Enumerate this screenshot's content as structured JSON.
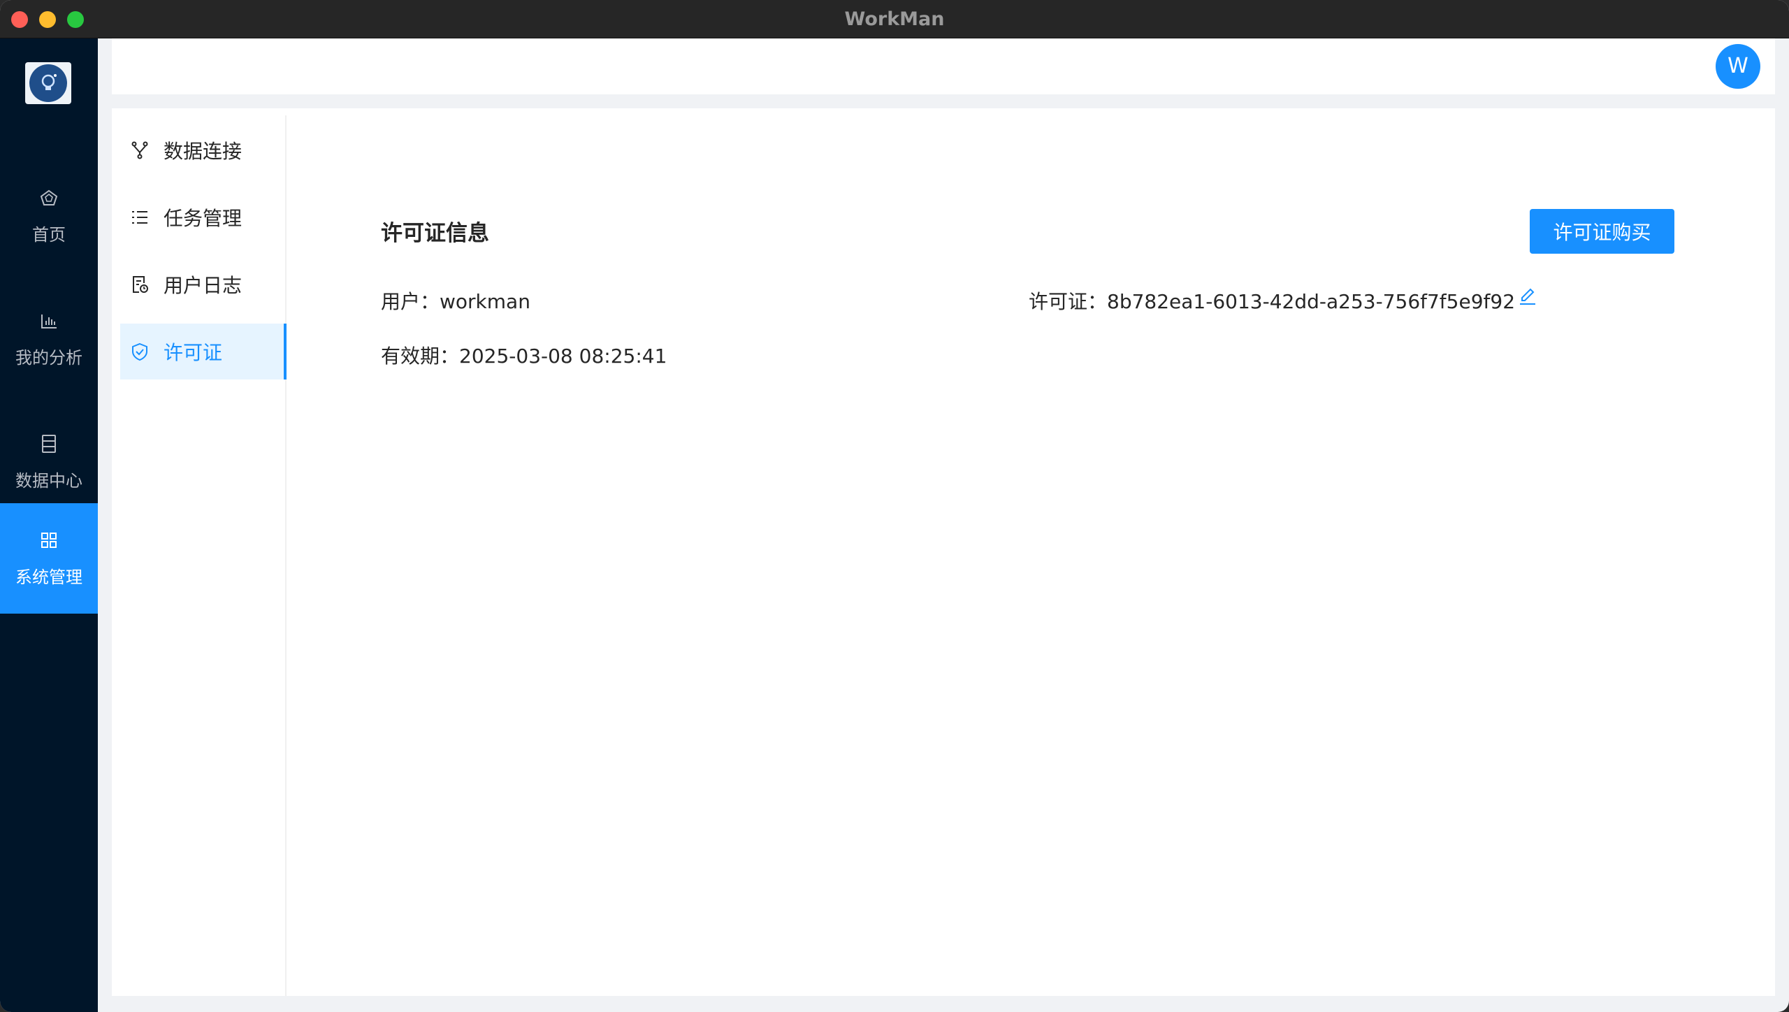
{
  "window": {
    "title": "WorkMan"
  },
  "rail": {
    "items": [
      {
        "label": "首页",
        "icon": "home-icon"
      },
      {
        "label": "我的分析",
        "icon": "bar-chart-icon"
      },
      {
        "label": "数据中心",
        "icon": "database-icon"
      },
      {
        "label": "系统管理",
        "icon": "grid-icon",
        "active": true
      }
    ]
  },
  "header": {
    "avatar_letter": "W"
  },
  "subnav": {
    "items": [
      {
        "label": "数据连接",
        "icon": "fork-icon"
      },
      {
        "label": "任务管理",
        "icon": "list-icon"
      },
      {
        "label": "用户日志",
        "icon": "log-file-icon"
      },
      {
        "label": "许可证",
        "icon": "shield-icon",
        "active": true
      }
    ]
  },
  "license": {
    "title": "许可证信息",
    "buy_label": "许可证购买",
    "user_label": "用户：",
    "user_value": "workman",
    "license_label": "许可证：",
    "license_value": "8b782ea1-6013-42dd-a253-756f7f5e9f92",
    "expiry_label": "有效期：",
    "expiry_value": "2025-03-08 08:25:41"
  },
  "colors": {
    "accent": "#1890ff",
    "rail_bg": "#001529"
  }
}
